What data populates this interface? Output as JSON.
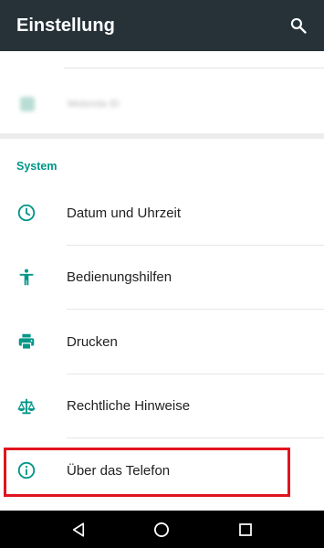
{
  "appbar": {
    "title": "Einstellung",
    "search_icon": "search-icon"
  },
  "blurred_item": {
    "label": "Motorola ID"
  },
  "system": {
    "header": "System",
    "items": [
      {
        "label": "Datum und Uhrzeit",
        "icon": "clock-icon"
      },
      {
        "label": "Bedienungshilfen",
        "icon": "accessibility-icon"
      },
      {
        "label": "Drucken",
        "icon": "printer-icon"
      },
      {
        "label": "Rechtliche Hinweise",
        "icon": "scale-icon"
      },
      {
        "label": "Über das Telefon",
        "icon": "info-icon"
      }
    ]
  },
  "navbar": {
    "buttons": [
      "back-icon",
      "home-icon",
      "recents-icon"
    ]
  },
  "colors": {
    "appbar": "#263238",
    "accent": "#009688",
    "highlight": "#e0141e"
  }
}
